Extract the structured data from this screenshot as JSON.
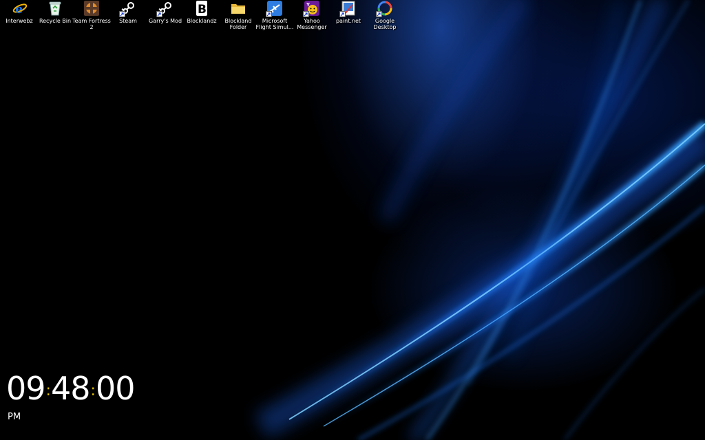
{
  "desktop": {
    "icons": [
      {
        "label": "Interwebz",
        "icon": "internet-explorer-icon",
        "shortcut": false
      },
      {
        "label": "Recycle Bin",
        "icon": "recycle-bin-icon",
        "shortcut": false
      },
      {
        "label": "Team Fortress 2",
        "icon": "team-fortress-2-icon",
        "shortcut": false
      },
      {
        "label": "Steam",
        "icon": "steam-icon",
        "shortcut": true
      },
      {
        "label": "Garry's Mod",
        "icon": "steam-icon",
        "shortcut": true
      },
      {
        "label": "Blocklandz",
        "icon": "blockland-icon",
        "shortcut": false
      },
      {
        "label": "Blockland Folder",
        "icon": "folder-icon",
        "shortcut": false
      },
      {
        "label": "Microsoft Flight Simul...",
        "icon": "flight-simulator-icon",
        "shortcut": true
      },
      {
        "label": "Yahoo Messenger",
        "icon": "yahoo-messenger-icon",
        "shortcut": true
      },
      {
        "label": "paint.net",
        "icon": "paint-net-icon",
        "shortcut": true
      },
      {
        "label": "Google Desktop",
        "icon": "google-desktop-icon",
        "shortcut": true
      }
    ]
  },
  "clock": {
    "hours": "09",
    "minutes": "48",
    "seconds": "00",
    "separator": ":",
    "ampm": "PM"
  },
  "colors": {
    "background": "#000000",
    "accent": "#1e7bff",
    "clock_separator": "#e0c000"
  }
}
